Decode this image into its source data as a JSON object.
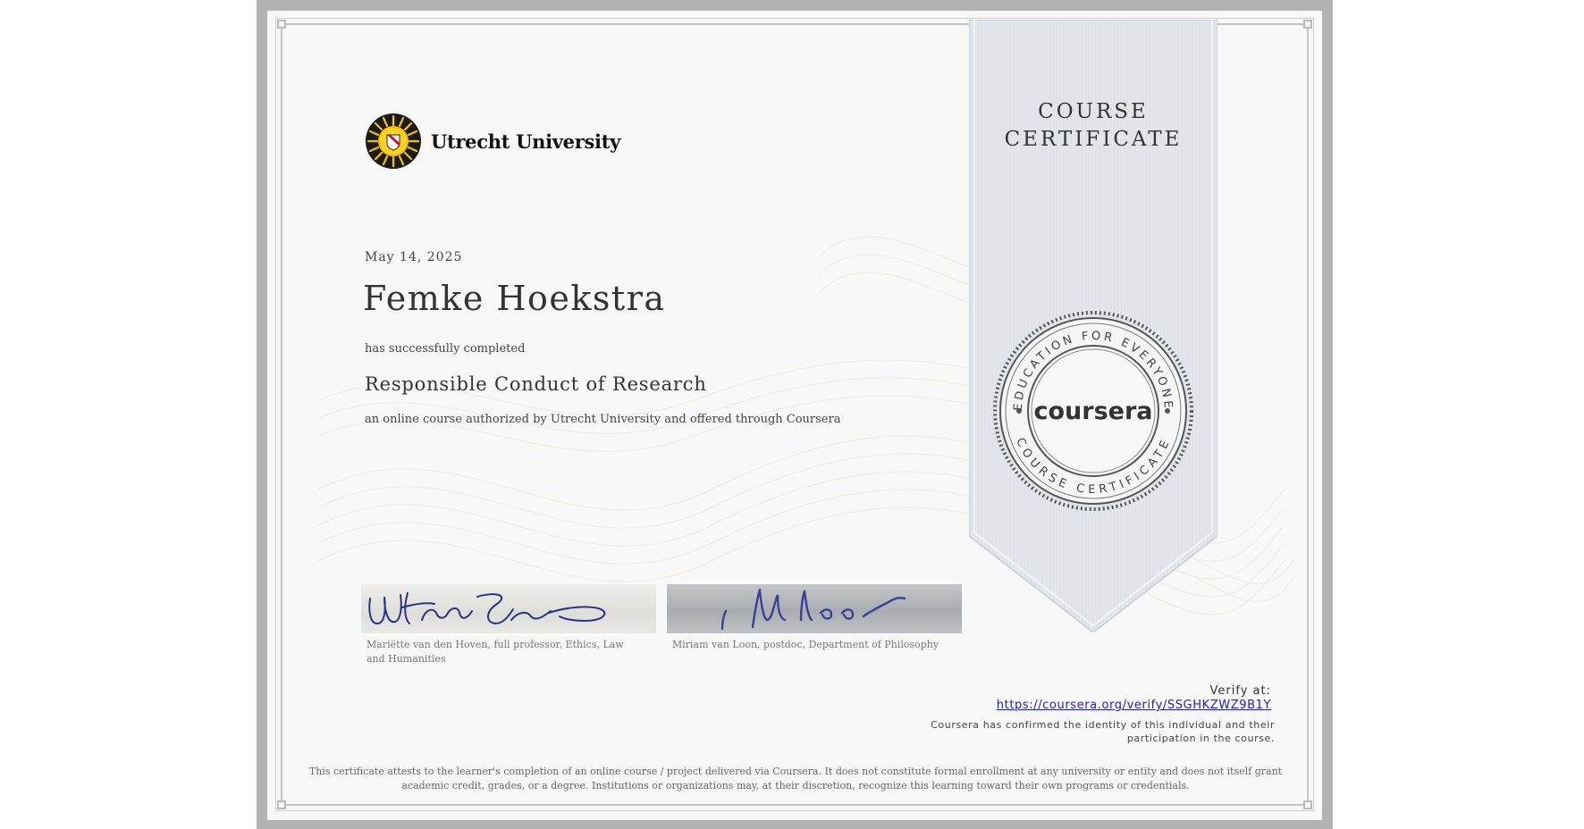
{
  "certificate": {
    "type_label": "COURSE CERTIFICATE",
    "date": "May 14, 2025",
    "recipient_name": "Femke Hoekstra",
    "completed_text": "has successfully completed",
    "course_title": "Responsible Conduct of Research",
    "authorized_text": "an online course authorized by Utrecht University and offered through Coursera"
  },
  "university": {
    "name": "Utrecht University",
    "logo_icon": "sun-crest-icon",
    "colors": {
      "gold": "#f2c200",
      "red": "#c8102e"
    }
  },
  "seal": {
    "brand": "coursera",
    "top_arc": "EDUCATION FOR EVERYONE",
    "bottom_arc": "COURSE CERTIFICATE"
  },
  "signatories": [
    {
      "caption": "Mariëtte van den Hoven, full professor, Ethics, Law and Humanities"
    },
    {
      "caption": "Miriam van Loon, postdoc, Department of Philosophy"
    }
  ],
  "verification": {
    "label": "Verify at:",
    "url": "https://coursera.org/verify/SSGHKZWZ9B1Y",
    "identity_note": "Coursera has confirmed the identity of this individual and their participation in the course."
  },
  "disclaimer": "This certificate attests to the learner's completion of an online course / project delivered via Coursera. It does not constitute formal enrollment at any university or entity and does not itself grant academic credit, grades, or a degree. Institutions or organizations may, at their discretion, recognize this learning toward their own programs or credentials.",
  "colors": {
    "ribbon": "#dfe3e8",
    "mat": "#b3b3b3",
    "link": "#2222aa"
  }
}
